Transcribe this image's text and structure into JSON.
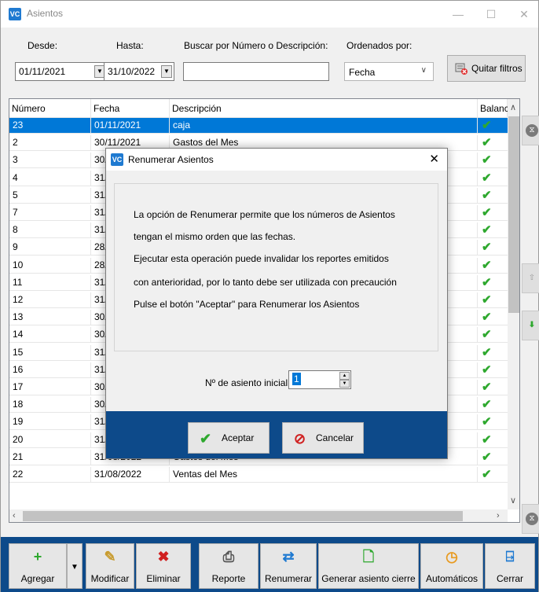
{
  "window": {
    "title": "Asientos",
    "app_icon": "VC"
  },
  "filters": {
    "desde_label": "Desde:",
    "desde_value": "01/11/2021",
    "hasta_label": "Hasta:",
    "hasta_value": "31/10/2022",
    "buscar_label": "Buscar por Número o Descripción:",
    "buscar_value": "",
    "ordenados_label": "Ordenados por:",
    "ordenados_value": "Fecha",
    "quitar_filtros": "Quitar filtros"
  },
  "table": {
    "headers": [
      "Número",
      "Fecha",
      "Descripción",
      "Balanc"
    ],
    "rows": [
      {
        "numero": "23",
        "fecha": "01/11/2021",
        "descripcion": "caja",
        "selected": true
      },
      {
        "numero": "2",
        "fecha": "30/11/2021",
        "descripcion": "Gastos del Mes"
      },
      {
        "numero": "3",
        "fecha": "30/",
        "descripcion": ""
      },
      {
        "numero": "4",
        "fecha": "31/",
        "descripcion": ""
      },
      {
        "numero": "5",
        "fecha": "31/",
        "descripcion": ""
      },
      {
        "numero": "7",
        "fecha": "31/",
        "descripcion": ""
      },
      {
        "numero": "8",
        "fecha": "31/",
        "descripcion": ""
      },
      {
        "numero": "9",
        "fecha": "28/",
        "descripcion": ""
      },
      {
        "numero": "10",
        "fecha": "28/",
        "descripcion": ""
      },
      {
        "numero": "11",
        "fecha": "31/",
        "descripcion": ""
      },
      {
        "numero": "12",
        "fecha": "31/",
        "descripcion": ""
      },
      {
        "numero": "13",
        "fecha": "30/",
        "descripcion": ""
      },
      {
        "numero": "14",
        "fecha": "30/",
        "descripcion": ""
      },
      {
        "numero": "15",
        "fecha": "31/",
        "descripcion": ""
      },
      {
        "numero": "16",
        "fecha": "31/",
        "descripcion": ""
      },
      {
        "numero": "17",
        "fecha": "30/",
        "descripcion": ""
      },
      {
        "numero": "18",
        "fecha": "30/",
        "descripcion": ""
      },
      {
        "numero": "19",
        "fecha": "31/",
        "descripcion": ""
      },
      {
        "numero": "20",
        "fecha": "31/",
        "descripcion": ""
      },
      {
        "numero": "21",
        "fecha": "31/08/2022",
        "descripcion": "Gastos del Mes"
      },
      {
        "numero": "22",
        "fecha": "31/08/2022",
        "descripcion": "Ventas del Mes"
      }
    ]
  },
  "toolbar": {
    "agregar": "Agregar",
    "modificar": "Modificar",
    "eliminar": "Eliminar",
    "reporte": "Reporte",
    "renumerar": "Renumerar",
    "generar_cierre": "Generar asiento cierre",
    "automaticos": "Automáticos",
    "cerrar": "Cerrar"
  },
  "dialog": {
    "title": "Renumerar Asientos",
    "lines": [
      "La opción de Renumerar permite que los números de Asientos",
      "tengan el mismo orden que las fechas.",
      "Ejecutar esta operación puede invalidar los reportes emitidos",
      "con anterioridad, por lo tanto debe ser utilizada con precaución",
      "Pulse el botón \"Aceptar\" para Renumerar los Asientos"
    ],
    "spin_label": "Nº de asiento inicial:",
    "spin_value": "1",
    "aceptar": "Aceptar",
    "cancelar": "Cancelar"
  },
  "colors": {
    "accent": "#0d4a8a",
    "selection": "#0078d7",
    "check": "#2ea82e"
  }
}
